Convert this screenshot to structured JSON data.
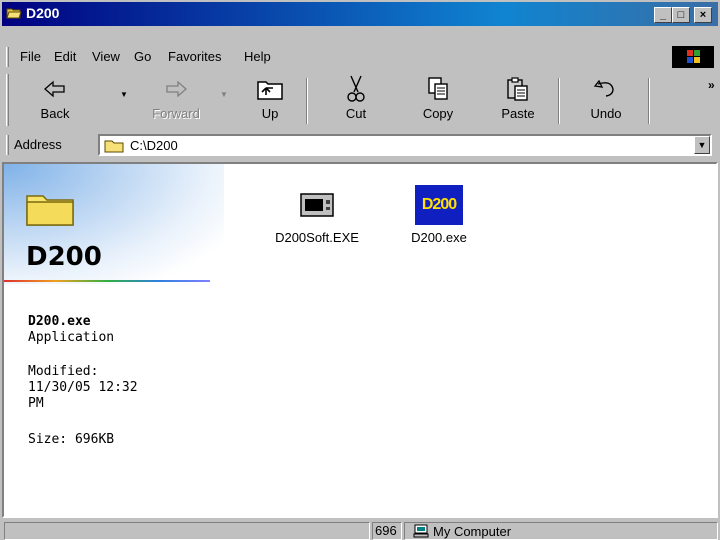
{
  "window": {
    "title": "D200"
  },
  "title_buttons": {
    "minimize": "_",
    "maximize": "□",
    "close": "×"
  },
  "menu": [
    "File",
    "Edit",
    "View",
    "Go",
    "Favorites",
    "Help"
  ],
  "toolbar": {
    "buttons": [
      {
        "label": "Back",
        "icon": "back-arrow-icon",
        "enabled": true,
        "dropdown": true
      },
      {
        "label": "Forward",
        "icon": "forward-arrow-icon",
        "enabled": false,
        "dropdown": true
      },
      {
        "label": "Up",
        "icon": "up-folder-icon",
        "enabled": true
      },
      {
        "label": "Cut",
        "icon": "scissors-icon",
        "enabled": true
      },
      {
        "label": "Copy",
        "icon": "copy-icon",
        "enabled": true
      },
      {
        "label": "Paste",
        "icon": "paste-icon",
        "enabled": true
      },
      {
        "label": "Undo",
        "icon": "undo-icon",
        "enabled": true
      }
    ],
    "overflow": "»"
  },
  "address": {
    "label": "Address",
    "value": "C:\\D200"
  },
  "panel": {
    "folder_name": "D200",
    "selected_name": "D200.exe",
    "selected_type": "Application",
    "modified_label": "Modified:",
    "modified_date": "11/30/05 12:32",
    "modified_ampm": "PM",
    "size": "Size: 696KB"
  },
  "files": [
    {
      "name": "D200Soft.EXE",
      "icon": "application-window-icon"
    },
    {
      "name": "D200.exe",
      "icon": "d200-app-icon",
      "icon_text": "D200",
      "selected": true
    }
  ],
  "status": {
    "size_text": "696",
    "zone": "My Computer"
  }
}
